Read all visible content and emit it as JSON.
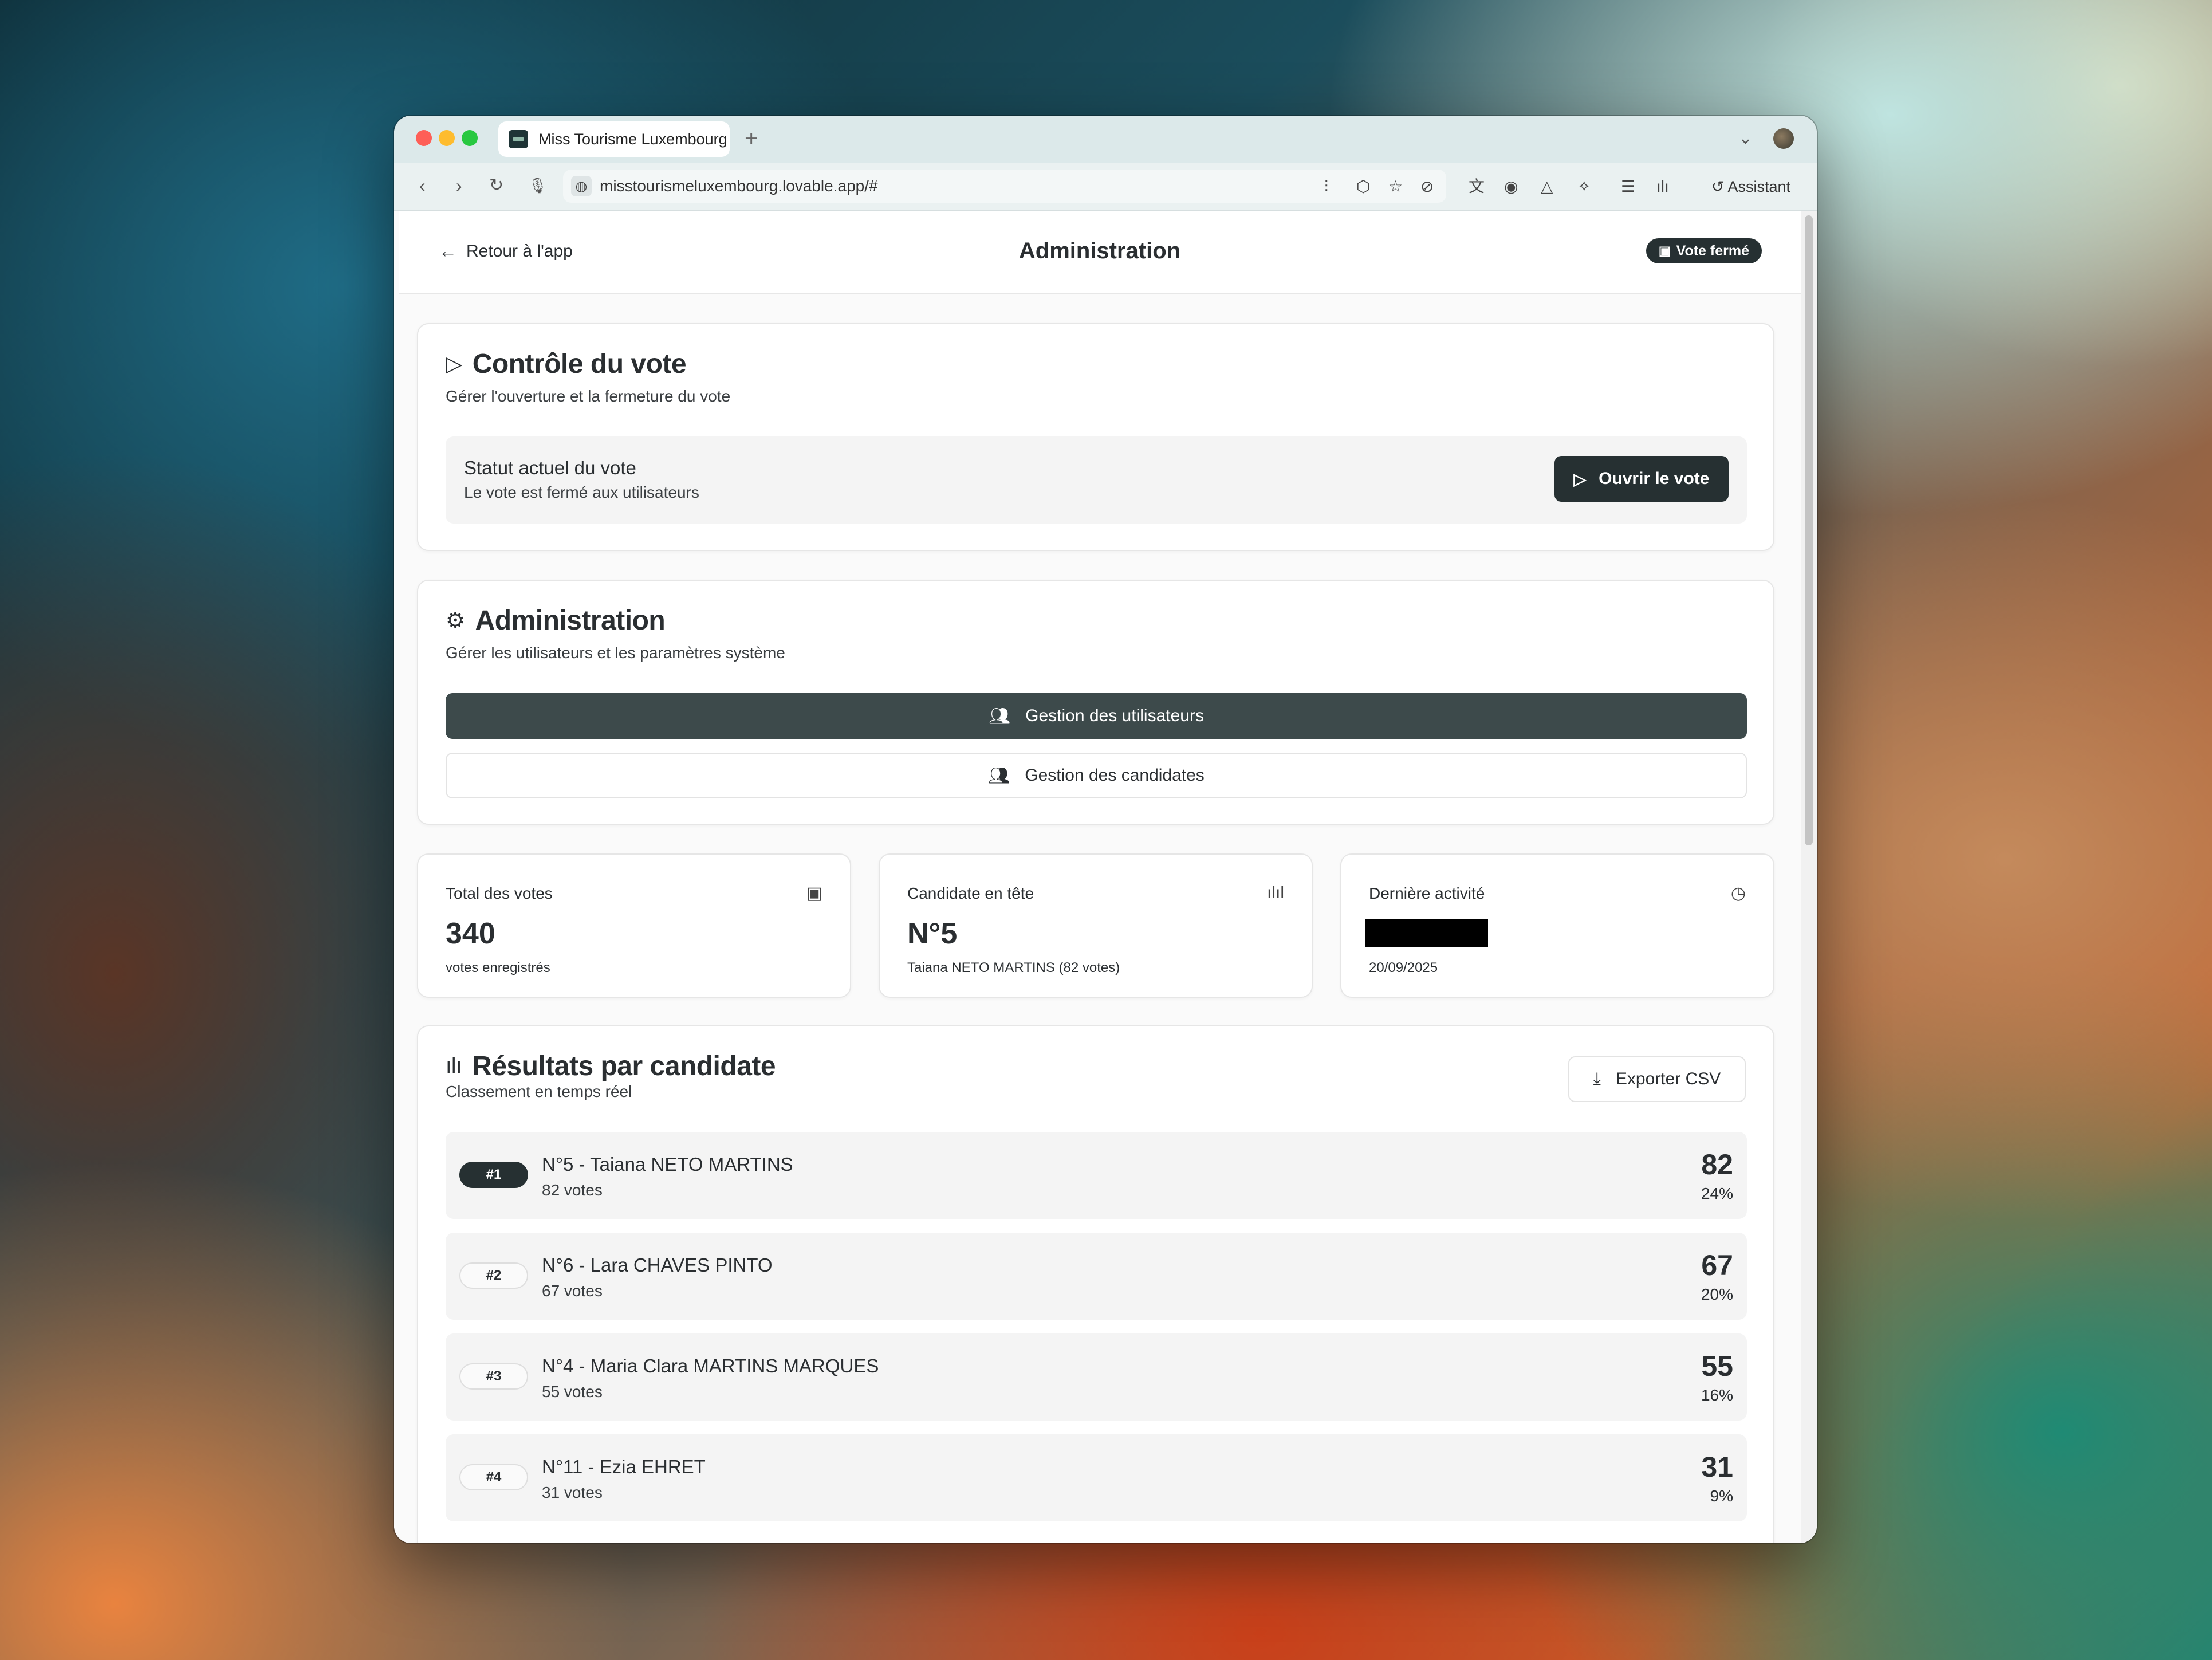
{
  "browser": {
    "tab_title": "Miss Tourisme Luxembourg",
    "new_tab": "+",
    "url": "misstourismeluxembourg.lovable.app/#",
    "assistant_label": "Assistant"
  },
  "header": {
    "back_label": "Retour à l'app",
    "title": "Administration",
    "status_badge": "Vote fermé"
  },
  "vote_control": {
    "title": "Contrôle du vote",
    "subtitle": "Gérer l'ouverture et la fermeture du vote",
    "status_label": "Statut actuel du vote",
    "status_desc": "Le vote est fermé aux utilisateurs",
    "open_button": "Ouvrir le vote"
  },
  "administration": {
    "title": "Administration",
    "subtitle": "Gérer les utilisateurs et les paramètres système",
    "users_button": "Gestion des utilisateurs",
    "candidates_button": "Gestion des candidates"
  },
  "stats": {
    "total": {
      "label": "Total des votes",
      "value": "340",
      "sub": "votes enregistrés"
    },
    "leader": {
      "label": "Candidate en tête",
      "value": "N°5",
      "sub": "Taiana NETO MARTINS (82 votes)"
    },
    "activity": {
      "label": "Dernière activité",
      "sub": "20/09/2025"
    }
  },
  "results": {
    "title": "Résultats par candidate",
    "subtitle": "Classement en temps réel",
    "export_button": "Exporter CSV",
    "rows": [
      {
        "rank": "#1",
        "name": "N°5 - Taiana NETO MARTINS",
        "votes_text": "82 votes",
        "count": "82",
        "pct": "24%"
      },
      {
        "rank": "#2",
        "name": "N°6 - Lara CHAVES PINTO",
        "votes_text": "67 votes",
        "count": "67",
        "pct": "20%"
      },
      {
        "rank": "#3",
        "name": "N°4 - Maria Clara MARTINS MARQUES",
        "votes_text": "55 votes",
        "count": "55",
        "pct": "16%"
      },
      {
        "rank": "#4",
        "name": "N°11 - Ezia EHRET",
        "votes_text": "31 votes",
        "count": "31",
        "pct": "9%"
      }
    ]
  },
  "colors": {
    "dark_accent": "#263032",
    "button_dark": "#3d4a4b",
    "panel_bg": "#f4f4f4"
  }
}
